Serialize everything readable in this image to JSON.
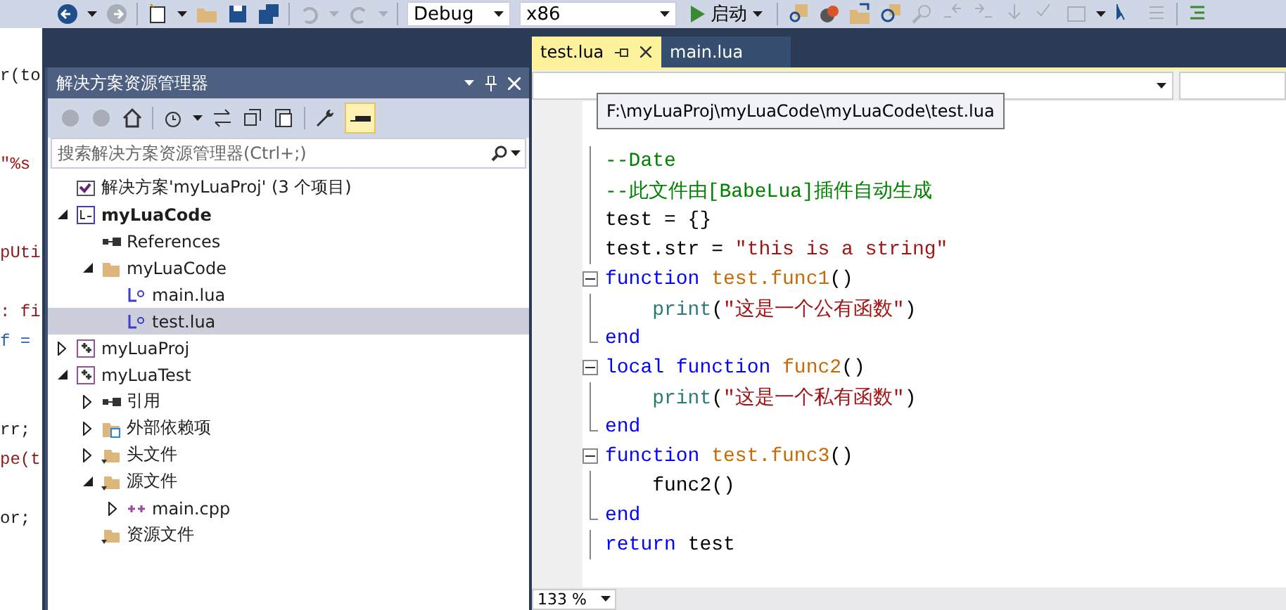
{
  "toolbar": {
    "config": "Debug",
    "platform": "x86",
    "start": "启动"
  },
  "background_code": [
    {
      "kind": "plain",
      "text": "r(to"
    },
    {
      "kind": "blank"
    },
    {
      "kind": "blank"
    },
    {
      "kind": "string",
      "text": "\"%s"
    },
    {
      "kind": "blank"
    },
    {
      "kind": "blank"
    },
    {
      "kind": "func",
      "text": "pUti"
    },
    {
      "kind": "blank"
    },
    {
      "kind": "func",
      "text": ": fi"
    },
    {
      "kind": "type",
      "text": "f = "
    },
    {
      "kind": "blank"
    },
    {
      "kind": "blank"
    },
    {
      "kind": "plain",
      "text": "rr;"
    },
    {
      "kind": "func",
      "text": "pe(t"
    },
    {
      "kind": "blank"
    },
    {
      "kind": "plain",
      "text": "or;"
    }
  ],
  "solution_explorer": {
    "title": "解决方案资源管理器",
    "search": {
      "placeholder": "搜索解决方案资源管理器(Ctrl+;)"
    },
    "tree": [
      {
        "kind": "solution",
        "label": "解决方案'myLuaProj' (3 个项目)",
        "selected": false,
        "bold": false
      },
      {
        "kind": "lua-project",
        "label": "myLuaCode",
        "expanded": true,
        "selected": false,
        "bold": true,
        "children": [
          {
            "kind": "references",
            "label": "References",
            "selected": false,
            "bold": false
          },
          {
            "kind": "folder",
            "label": "myLuaCode",
            "expanded": true,
            "selected": false,
            "bold": false,
            "children": [
              {
                "kind": "lua-file",
                "label": "main.lua",
                "selected": false,
                "bold": false
              },
              {
                "kind": "lua-file",
                "label": "test.lua",
                "selected": true,
                "bold": false
              }
            ]
          }
        ]
      },
      {
        "kind": "cpp-project",
        "label": "myLuaProj",
        "expanded": false,
        "selected": false,
        "bold": false
      },
      {
        "kind": "cpp-project",
        "label": "myLuaTest",
        "expanded": true,
        "selected": false,
        "bold": false,
        "children": [
          {
            "kind": "references",
            "label": "引用",
            "expanded": false,
            "selected": false,
            "bold": false
          },
          {
            "kind": "external",
            "label": "外部依赖项",
            "expanded": false,
            "selected": false,
            "bold": false
          },
          {
            "kind": "filter",
            "label": "头文件",
            "expanded": false,
            "selected": false,
            "bold": false
          },
          {
            "kind": "filter",
            "label": "源文件",
            "expanded": true,
            "selected": false,
            "bold": false,
            "children": [
              {
                "kind": "cpp-file",
                "label": "main.cpp",
                "expanded": false,
                "selected": false,
                "bold": false
              }
            ]
          },
          {
            "kind": "filter",
            "label": "资源文件",
            "selected": false,
            "bold": false
          }
        ]
      }
    ]
  },
  "editor": {
    "tabs": [
      {
        "label": "test.lua",
        "selected": true
      },
      {
        "label": "main.lua",
        "selected": false
      }
    ],
    "tooltip": "F:\\myLuaProj\\myLuaCode\\myLuaCode\\test.lua",
    "lines": [
      {
        "kind": "plain",
        "tokens": [
          {
            "kind": "comment",
            "text": "--Date"
          }
        ]
      },
      {
        "kind": "plain",
        "tokens": [
          {
            "kind": "comment",
            "text": "--此文件由[BabeLua]插件自动生成"
          }
        ]
      },
      {
        "kind": "plain",
        "tokens": [
          {
            "kind": "plain",
            "text": "test = {}"
          }
        ]
      },
      {
        "kind": "plain",
        "tokens": [
          {
            "kind": "plain",
            "text": "test.str = "
          },
          {
            "kind": "string",
            "text": "\"this is a string\""
          }
        ]
      },
      {
        "kind": "fold-start",
        "tokens": [
          {
            "kind": "keyword",
            "text": "function "
          },
          {
            "kind": "name",
            "text": "test.func1"
          },
          {
            "kind": "plain",
            "text": "()"
          }
        ]
      },
      {
        "kind": "plain",
        "tokens": [
          {
            "kind": "builtin",
            "text": "    print"
          },
          {
            "kind": "plain",
            "text": "("
          },
          {
            "kind": "string",
            "text": "\"这是一个公有函数\""
          },
          {
            "kind": "plain",
            "text": ")"
          }
        ]
      },
      {
        "kind": "fold-end",
        "tokens": [
          {
            "kind": "keyword",
            "text": "end"
          }
        ]
      },
      {
        "kind": "fold-start",
        "tokens": [
          {
            "kind": "keyword",
            "text": "local function "
          },
          {
            "kind": "name",
            "text": "func2"
          },
          {
            "kind": "plain",
            "text": "()"
          }
        ]
      },
      {
        "kind": "plain",
        "tokens": [
          {
            "kind": "builtin",
            "text": "    print"
          },
          {
            "kind": "plain",
            "text": "("
          },
          {
            "kind": "string",
            "text": "\"这是一个私有函数\""
          },
          {
            "kind": "plain",
            "text": ")"
          }
        ]
      },
      {
        "kind": "fold-end",
        "tokens": [
          {
            "kind": "keyword",
            "text": "end"
          }
        ]
      },
      {
        "kind": "fold-start",
        "tokens": [
          {
            "kind": "keyword",
            "text": "function "
          },
          {
            "kind": "name",
            "text": "test.func3"
          },
          {
            "kind": "plain",
            "text": "()"
          }
        ]
      },
      {
        "kind": "plain",
        "tokens": [
          {
            "kind": "plain",
            "text": "    func2()"
          }
        ]
      },
      {
        "kind": "fold-end",
        "tokens": [
          {
            "kind": "keyword",
            "text": "end"
          }
        ]
      },
      {
        "kind": "plain",
        "tokens": [
          {
            "kind": "keyword",
            "text": "return "
          },
          {
            "kind": "plain",
            "text": "test"
          }
        ]
      }
    ],
    "zoom": "133 %"
  }
}
